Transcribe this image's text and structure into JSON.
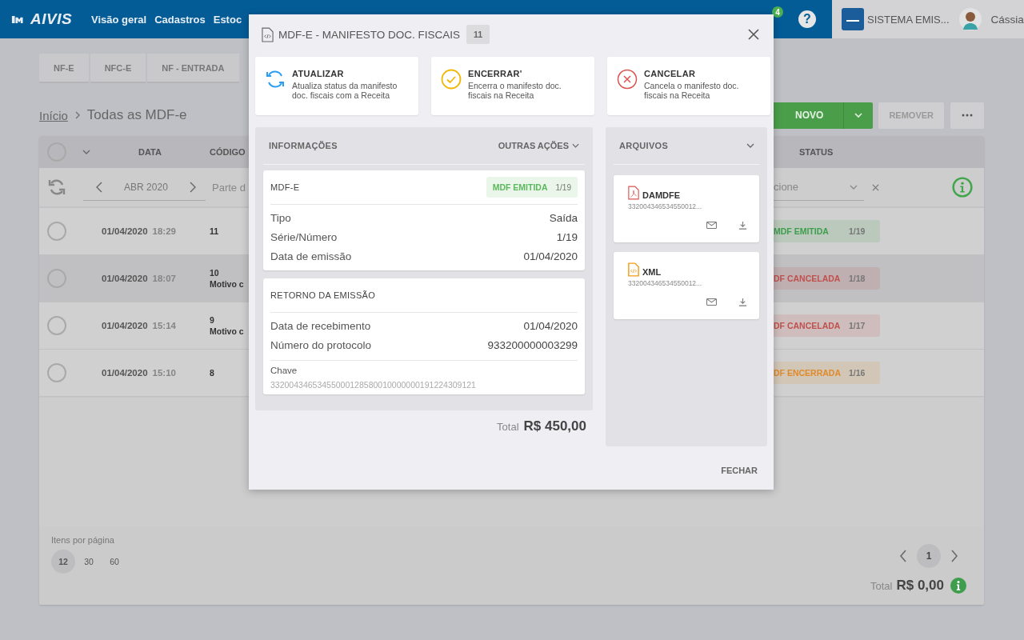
{
  "topbar": {
    "logo": "AIVIS",
    "nav": [
      "Visão geral",
      "Cadastros",
      "Estoc"
    ],
    "notification_count": "4",
    "help": "?",
    "company": "SISTEMA EMIS...",
    "user": "Cássia"
  },
  "tabs": [
    "NF-E",
    "NFC-E",
    "NF - ENTRADA"
  ],
  "breadcrumb": {
    "home": "Início",
    "current": "Todas as MDF-e"
  },
  "buttons": {
    "new": "NOVO",
    "remove": "REMOVER"
  },
  "table": {
    "all_selected": false,
    "columns": [
      "DATA",
      "CÓDIGO",
      "STATUS"
    ],
    "filter": {
      "period": "ABR 2020",
      "search_placeholder": "Parte d",
      "status_placeholder": "cione"
    },
    "rows": [
      {
        "date": "01/04/2020",
        "time": "18:29",
        "code": "11",
        "status": "MDF EMITIDA",
        "number": "1/19",
        "color": "#3f9e4d",
        "selected": false,
        "highlighted": false
      },
      {
        "date": "01/04/2020",
        "time": "18:07",
        "code": "10",
        "note": "Motivo c",
        "status": "DF CANCELADA",
        "number": "1/18",
        "color": "#c0504d",
        "selected": false,
        "highlighted": true
      },
      {
        "date": "01/04/2020",
        "time": "15:14",
        "code": "9",
        "note": "Motivo c",
        "status": "DF CANCELADA",
        "number": "1/17",
        "color": "#c0504d",
        "selected": false,
        "highlighted": false
      },
      {
        "date": "01/04/2020",
        "time": "15:10",
        "code": "8",
        "status": "DF ENCERRADA",
        "number": "1/16",
        "color": "#e08a2a",
        "selected": false,
        "highlighted": false
      }
    ]
  },
  "pagination": {
    "per_page_label": "Itens por página",
    "per_page_options": [
      {
        "label": "12",
        "selected": true
      },
      {
        "label": "30",
        "selected": false
      },
      {
        "label": "60",
        "selected": false
      }
    ],
    "page": "1",
    "total_label": "Total",
    "total": "R$ 0,00"
  },
  "modal": {
    "title": "MDF-E - MANIFESTO DOC. FISCAIS",
    "count": "11",
    "actions": [
      {
        "kind": "refresh",
        "title": "ATUALIZAR",
        "description": "Atualiza status da manifesto doc. fiscais com a Receita"
      },
      {
        "kind": "check",
        "title": "ENCERRAR'",
        "description": "Encerra o manifesto doc. fiscais na Receita"
      },
      {
        "kind": "cancel",
        "title": "CANCELAR",
        "description": "Cancela o manifesto doc. fiscais na Receita"
      }
    ],
    "info": {
      "title": "INFORMAÇÕES",
      "menu": "OUTRAS AÇÕES",
      "document": {
        "title": "MDF-E",
        "status": "MDF EMITIDA",
        "number": "1/19",
        "color": "#5cb85c",
        "fields": [
          {
            "label": "Tipo",
            "value": "Saída"
          },
          {
            "label": "Série/Número",
            "value": "1/19"
          },
          {
            "label": "Data de emissão",
            "value": "01/04/2020"
          }
        ]
      },
      "return": {
        "title": "RETORNO DA EMISSÃO",
        "fields": [
          {
            "label": "Data de recebimento",
            "value": "01/04/2020"
          },
          {
            "label": "Número do protocolo",
            "value": "933200000003299"
          }
        ],
        "key_label": "Chave",
        "key": "33200434653455000128580010000000191224309121"
      }
    },
    "total_label": "Total",
    "total": "R$ 450,00",
    "files": {
      "title": "ARQUIVOS",
      "items": [
        {
          "kind": "pdf",
          "name": "DAMDFE",
          "key": "332004346534550012..."
        },
        {
          "kind": "xml",
          "name": "XML",
          "key": "332004346534550012..."
        }
      ]
    },
    "close_button": "FECHAR"
  }
}
